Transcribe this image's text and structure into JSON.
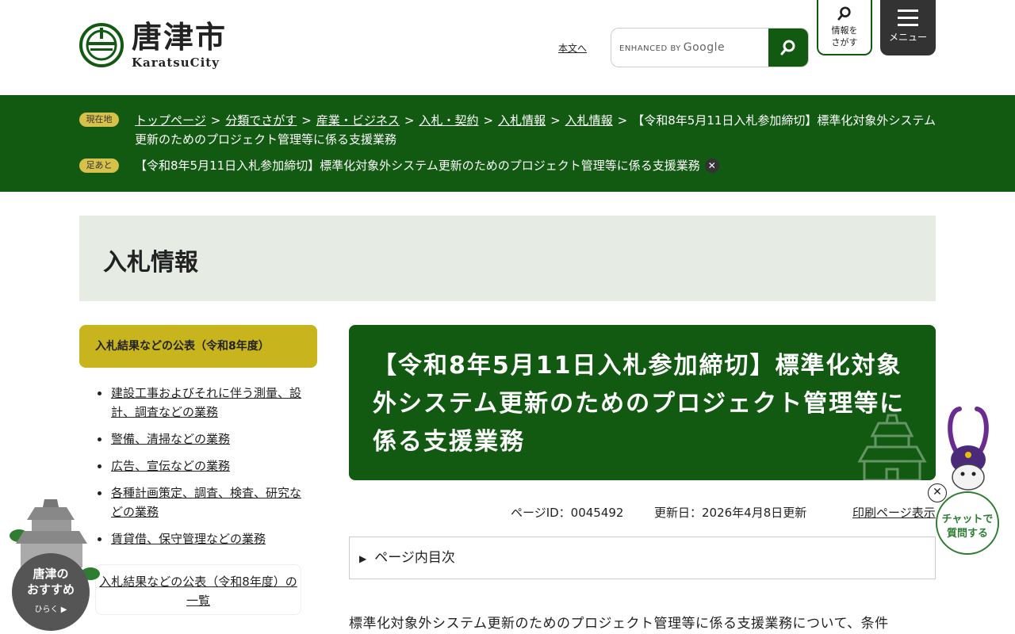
{
  "header": {
    "logo_jp": "唐津市",
    "logo_en": "KaratsuCity",
    "skip_link": "本文へ",
    "search_brand_prefix": "ENHANCED BY",
    "search_brand_google": "Google",
    "info_button": [
      "情報を",
      "さがす"
    ],
    "menu_button": "メニュー"
  },
  "breadcrumb": {
    "label": "現在地",
    "items": [
      "トップページ",
      "分類でさがす",
      "産業・ビジネス",
      "入札・契約",
      "入札情報",
      "入札情報"
    ],
    "separator": ">",
    "current": "【令和8年5月11日入札参加締切】標準化対象外システム更新のためのプロジェクト管理等に係る支援業務"
  },
  "footprint": {
    "label": "足あと",
    "item": "【令和8年5月11日入札参加締切】標準化対象外システム更新のためのプロジェクト管理等に係る支援業務",
    "close": "✕"
  },
  "banner": {
    "title": "入札情報"
  },
  "sidebar": {
    "heading": "入札結果などの公表（令和8年度）",
    "items": [
      "建設工事およびそれに伴う測量、設計、調査などの業務",
      "警備、清掃などの業務",
      "広告、宣伝などの業務",
      "各種計画策定、調査、検査、研究などの業務",
      "賃貸借、保守管理などの業務"
    ],
    "more_link": "入札結果などの公表（令和8年度）の一覧"
  },
  "main": {
    "title": "【令和8年5月11日入札参加締切】標準化対象外システム更新のためのプロジェクト管理等に係る支援業務",
    "page_id": "ページID：0045492",
    "updated": "更新日：2026年4月8日更新",
    "print_link": "印刷ページ表示",
    "toc_label": "ページ内目次",
    "toc_marker": "▶",
    "body": "標準化対象外システム更新のためのプロジェクト管理等に係る支援業務について、条件"
  },
  "widgets": {
    "chat_close": "✕",
    "chat_label": [
      "チャットで",
      "質問する"
    ],
    "recommend_label": [
      "唐津の",
      "おすすめ"
    ],
    "recommend_open": "ひらく"
  },
  "colors": {
    "brand_green": "#125a12",
    "pill_yellow": "#d6c24a",
    "side_head": "#c8b41c",
    "banner_bg": "#e6ece4"
  }
}
